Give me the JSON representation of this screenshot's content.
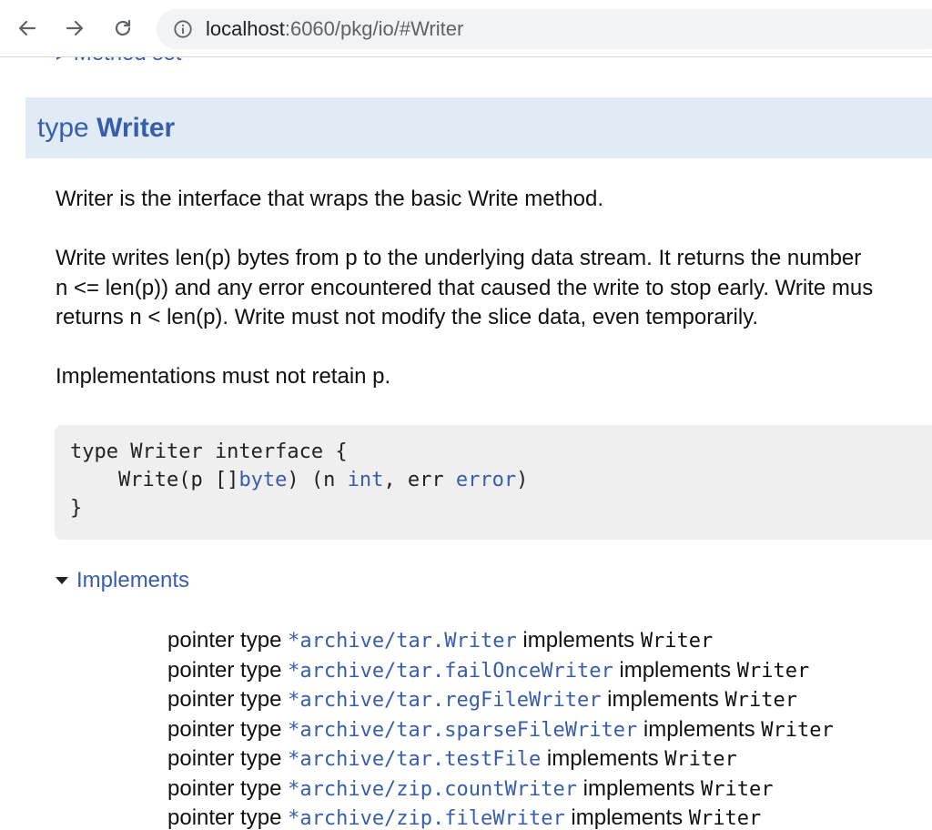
{
  "browser": {
    "url_host": "localhost",
    "url_path": ":6060/pkg/io/#Writer"
  },
  "page": {
    "cut_link": "▸ Method set",
    "type_keyword": "type",
    "type_name": "Writer",
    "paragraphs": [
      "Writer is the interface that wraps the basic Write method.",
      "Write writes len(p) bytes from p to the underlying data stream. It returns the number",
      "n <= len(p)) and any error encountered that caused the write to stop early. Write mus",
      "returns n < len(p). Write must not modify the slice data, even temporarily.",
      "Implementations must not retain p."
    ],
    "code": {
      "line1": "type Writer interface {",
      "line2_pre": "    Write(p []",
      "line2_byte": "byte",
      "line2_mid": ") (n ",
      "line2_int": "int",
      "line2_mid2": ", err ",
      "line2_error": "error",
      "line2_post": ")",
      "line3": "}"
    },
    "implements_label": "Implements",
    "implements": [
      {
        "prefix": "pointer type ",
        "star": "*",
        "type": "archive/tar.Writer",
        "mid": " implements ",
        "iface": "Writer"
      },
      {
        "prefix": "pointer type ",
        "star": "*",
        "type": "archive/tar.failOnceWriter",
        "mid": " implements ",
        "iface": "Writer"
      },
      {
        "prefix": "pointer type ",
        "star": "*",
        "type": "archive/tar.regFileWriter",
        "mid": " implements ",
        "iface": "Writer"
      },
      {
        "prefix": "pointer type ",
        "star": "*",
        "type": "archive/tar.sparseFileWriter",
        "mid": " implements ",
        "iface": "Writer"
      },
      {
        "prefix": "pointer type ",
        "star": "*",
        "type": "archive/tar.testFile",
        "mid": " implements ",
        "iface": "Writer"
      },
      {
        "prefix": "pointer type ",
        "star": "*",
        "type": "archive/zip.countWriter",
        "mid": " implements ",
        "iface": "Writer"
      },
      {
        "prefix": "pointer type ",
        "star": "*",
        "type": "archive/zip.fileWriter",
        "mid": " implements ",
        "iface": "Writer"
      }
    ]
  }
}
